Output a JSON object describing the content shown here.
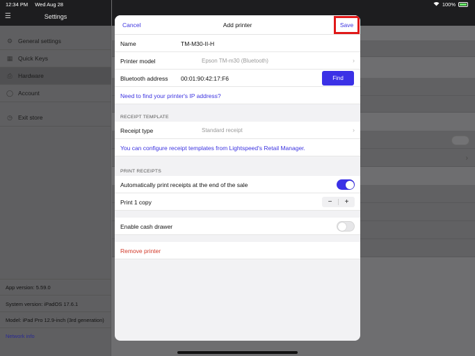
{
  "status_bar": {
    "time": "12:34 PM",
    "date": "Wed Aug 28",
    "battery": "100%"
  },
  "sidebar": {
    "title": "Settings",
    "items": [
      {
        "label": "General settings",
        "icon": "gear-icon"
      },
      {
        "label": "Quick Keys",
        "icon": "grid-icon"
      },
      {
        "label": "Hardware",
        "icon": "printer-icon"
      },
      {
        "label": "Account",
        "icon": "person-icon"
      },
      {
        "label": "Exit store",
        "icon": "clock-icon"
      }
    ],
    "info": {
      "app_version": "App version: 5.59.0",
      "system_version": "System version: iPadOS 17.6.1",
      "model": "Model: iPad Pro 12.9-inch (3rd generation)",
      "network_info": "Network info"
    }
  },
  "modal": {
    "cancel_label": "Cancel",
    "title": "Add printer",
    "save_label": "Save",
    "name_label": "Name",
    "name_value": "TM-M30-II-H",
    "printer_model_label": "Printer model",
    "printer_model_value": "Epson TM-m30 (Bluetooth)",
    "bluetooth_label": "Bluetooth address",
    "bluetooth_value": "00:01:90:42:17:F6",
    "find_label": "Find",
    "ip_help_link": "Need to find your printer's IP address?",
    "receipt_template_header": "RECEIPT TEMPLATE",
    "receipt_type_label": "Receipt type",
    "receipt_type_value": "Standard receipt",
    "receipt_config_link": "You can configure receipt templates from Lightspeed's Retail Manager.",
    "print_receipts_header": "PRINT RECEIPTS",
    "auto_print_label": "Automatically print receipts at the end of the sale",
    "auto_print_on": true,
    "print_copies_label": "Print 1 copy",
    "stepper_minus": "−",
    "stepper_plus": "+",
    "cash_drawer_label": "Enable cash drawer",
    "cash_drawer_on": false,
    "remove_label": "Remove printer"
  },
  "colors": {
    "accent": "#3b31e6",
    "danger": "#d23a2a",
    "highlight": "#e01818"
  }
}
